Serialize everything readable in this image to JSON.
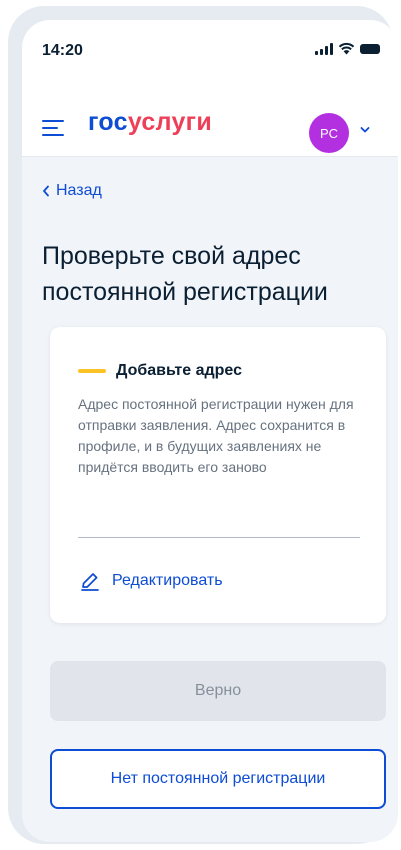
{
  "status_bar": {
    "time": "14:20",
    "icons": [
      "signal-icon",
      "wifi-icon",
      "battery-icon"
    ]
  },
  "header": {
    "logo_part1": "гос",
    "logo_part2": "услуги",
    "avatar_initials": "PC",
    "menu_icon": "hamburger-icon",
    "dropdown_icon": "chevron-down-icon"
  },
  "nav": {
    "back_label": "Назад"
  },
  "page": {
    "title": "Проверьте свой адрес постоянной регистрации"
  },
  "card": {
    "heading": "Добавьте адрес",
    "description": "Адрес постоянной регистрации нужен для отправки заявления. Адрес сохранится в профиле, и в будущих заявлениях не придётся вводить его заново",
    "edit_label": "Редактировать",
    "edit_icon": "pencil-icon"
  },
  "actions": {
    "confirm_label": "Верно",
    "confirm_disabled": true,
    "no_registration_label": "Нет постоянной регистрации"
  },
  "colors": {
    "primary": "#0d4cd3",
    "logo_accent": "#ee3f58",
    "avatar": "#b330e1",
    "heading_bar": "#fcc326",
    "background": "#f1f4f9",
    "disabled_button": "#e1e5eb"
  }
}
